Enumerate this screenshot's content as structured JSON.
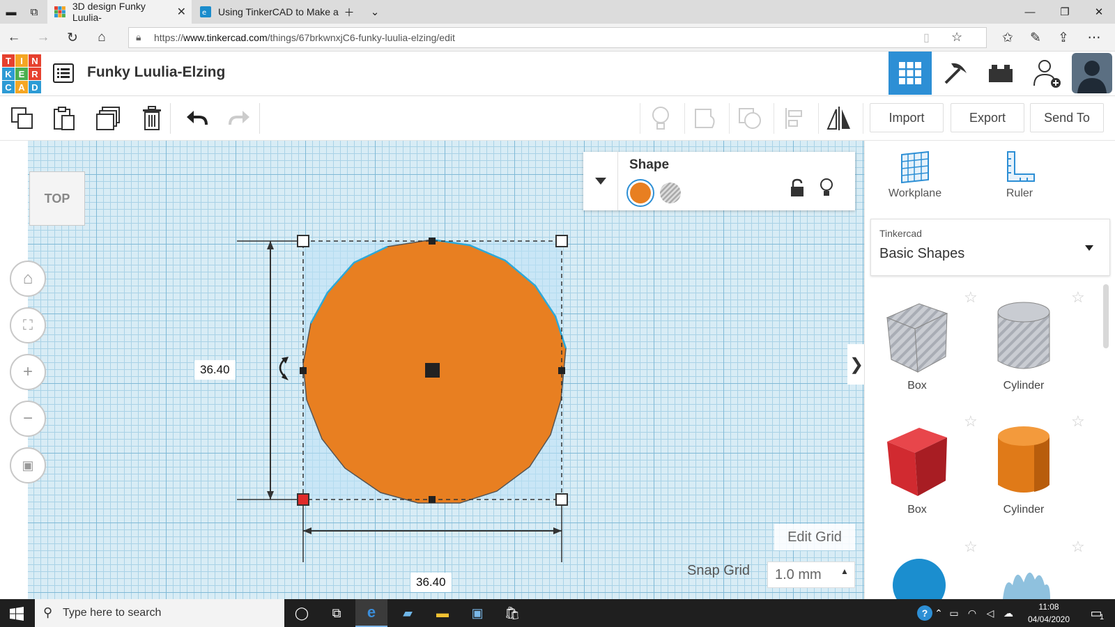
{
  "browser": {
    "tabs": [
      {
        "title": "3D design Funky Luulia-",
        "active": true
      },
      {
        "title": "Using TinkerCAD to Make a",
        "active": false
      }
    ],
    "url_prefix": "https://",
    "url_host": "www.tinkercad.com",
    "url_path": "/things/67brkwnxjC6-funky-luulia-elzing/edit"
  },
  "app": {
    "logo_letters": [
      "T",
      "I",
      "N",
      "K",
      "E",
      "R",
      "C",
      "A",
      "D"
    ],
    "design_name": "Funky Luulia-Elzing"
  },
  "toolbar": {
    "import_label": "Import",
    "export_label": "Export",
    "sendto_label": "Send To"
  },
  "workplane": {
    "view_label": "TOP",
    "dim_height": "36.40",
    "dim_width": "36.40",
    "edit_grid_label": "Edit Grid",
    "snap_grid_label": "Snap Grid",
    "snap_grid_value": "1.0 mm"
  },
  "inspector": {
    "title": "Shape",
    "color": "#e87f21"
  },
  "panel": {
    "workplane_label": "Workplane",
    "ruler_label": "Ruler",
    "library_category": "Tinkercad",
    "library_name": "Basic Shapes",
    "shapes": [
      {
        "name": "Box",
        "color": "#b9bcc2"
      },
      {
        "name": "Cylinder",
        "color": "#b9bcc2"
      },
      {
        "name": "Box",
        "color": "#d7262d"
      },
      {
        "name": "Cylinder",
        "color": "#e87f21"
      }
    ]
  },
  "taskbar": {
    "search_placeholder": "Type here to search",
    "time": "11:08",
    "date": "04/04/2020",
    "notification_count": "1"
  }
}
